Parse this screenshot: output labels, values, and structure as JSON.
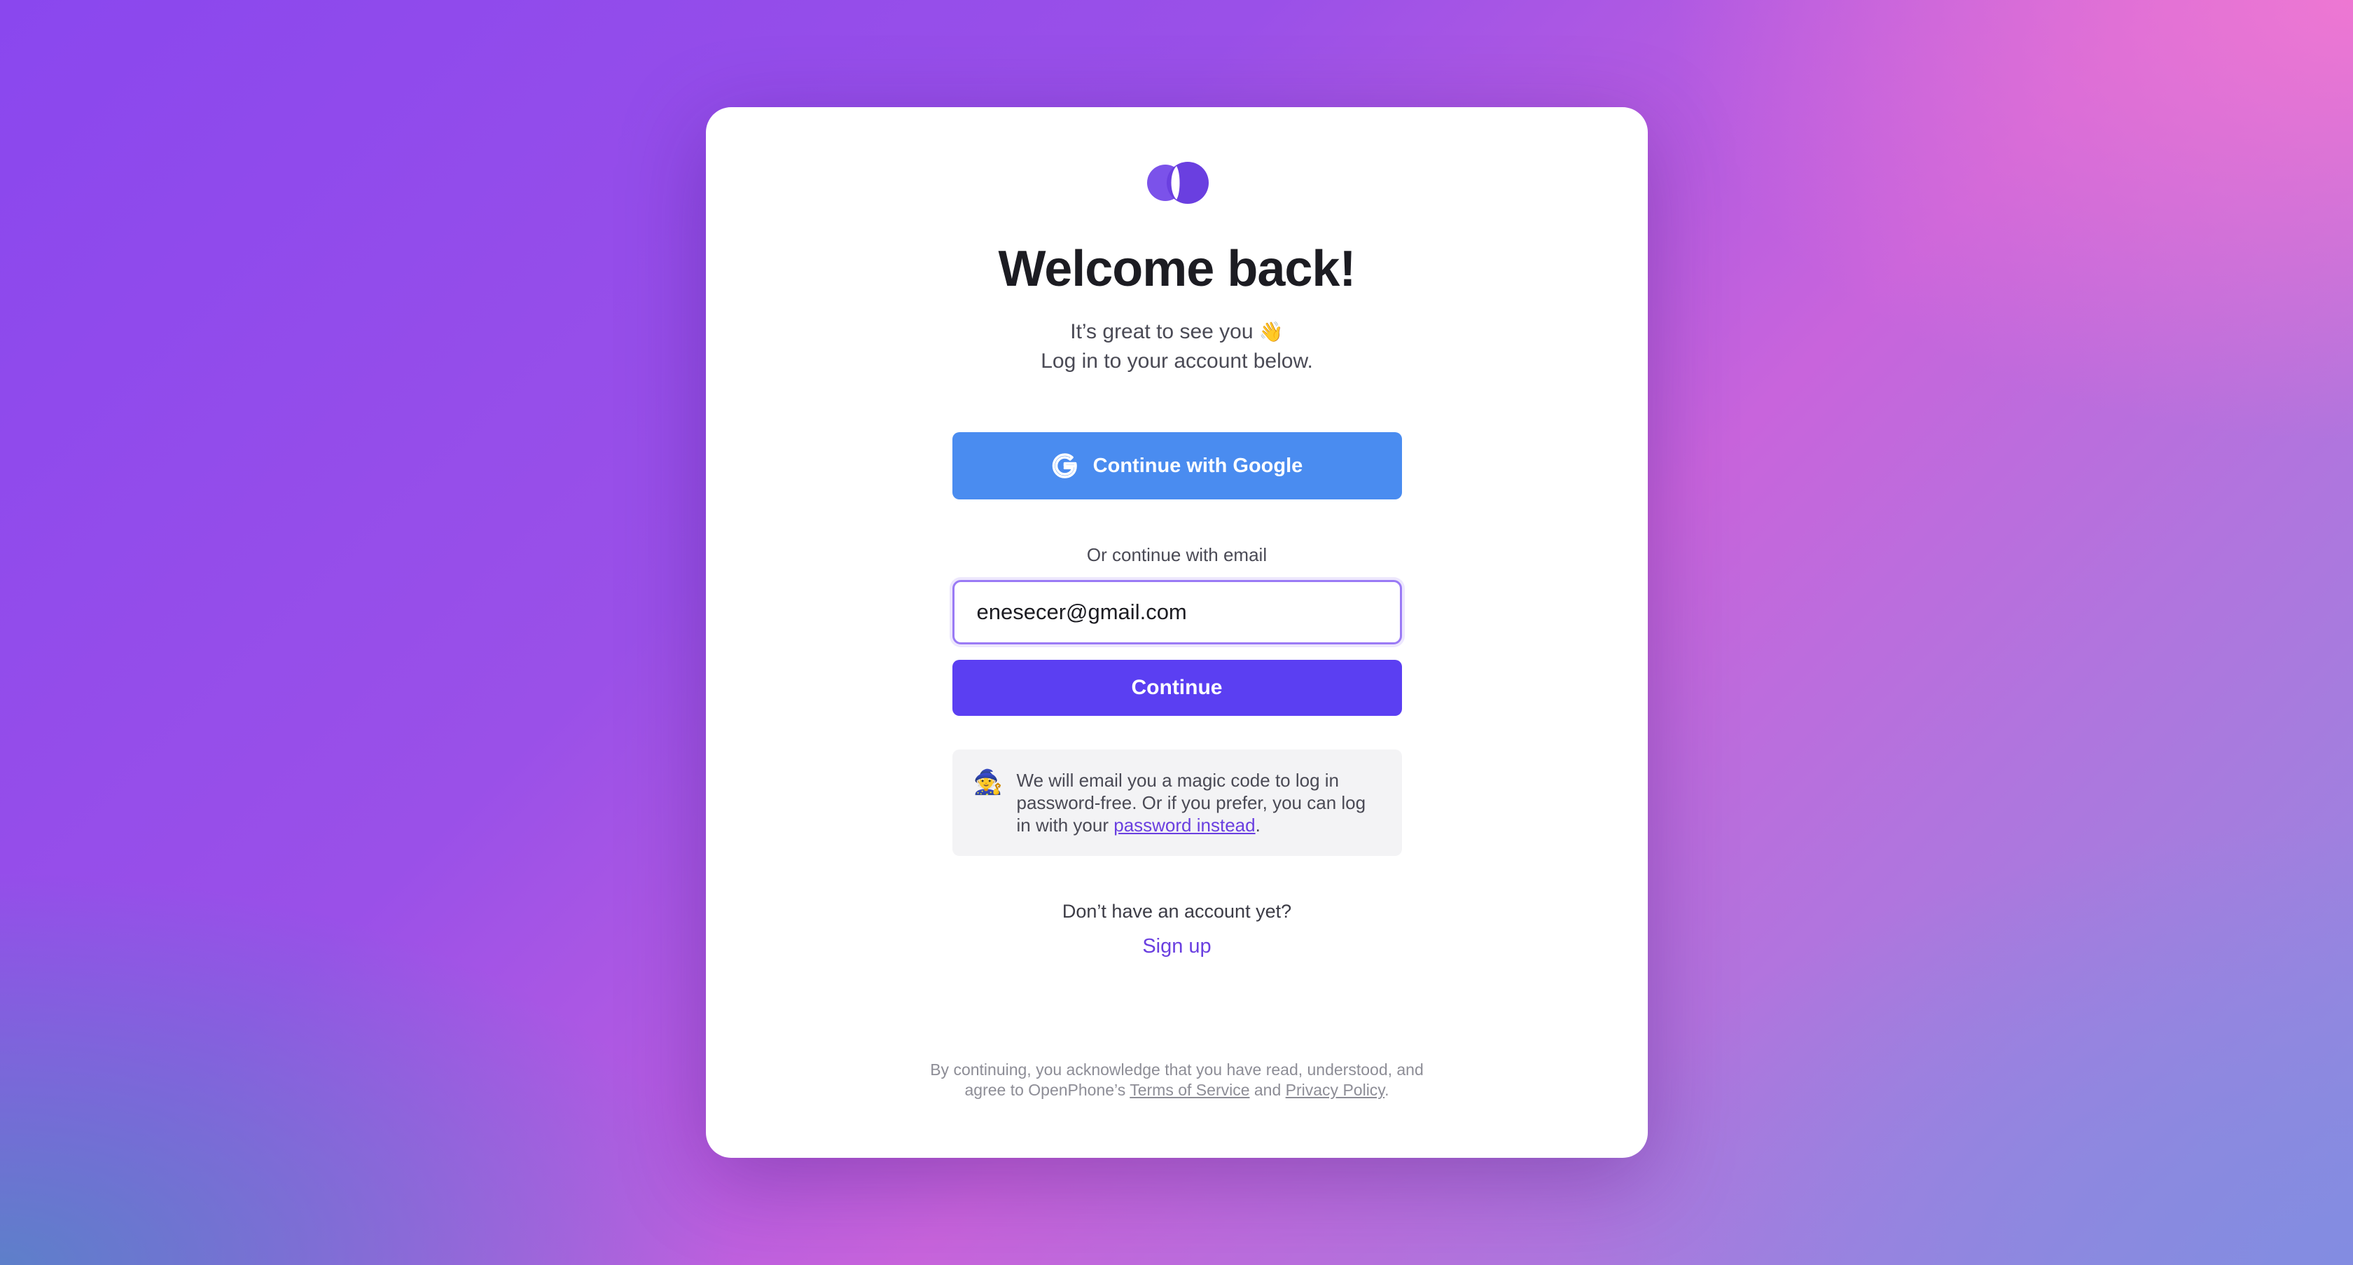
{
  "logo": {
    "icon": "openphone-logo-icon",
    "color": "#6a3fe0"
  },
  "heading": "Welcome back!",
  "subtitle": {
    "line1": "It’s great to see you",
    "wave_emoji": "👋",
    "line2": "Log in to your account below."
  },
  "google_button": {
    "label": "Continue with Google",
    "icon": "google-g-icon",
    "color": "#4a8cf0"
  },
  "email_section": {
    "or_label": "Or continue with email",
    "email_value": "enesecer@gmail.com",
    "continue_label": "Continue",
    "continue_color": "#5b3ff2"
  },
  "info": {
    "icon": "🧙",
    "text_before": "We will email you a magic code to log in password-free. Or if you prefer, you can log in with your ",
    "link": "password instead",
    "text_after": "."
  },
  "signup": {
    "prompt": "Don’t have an account yet?",
    "link": "Sign up"
  },
  "legal": {
    "line1": "By continuing, you acknowledge that you have read, understood, and",
    "line2_before": "agree to OpenPhone’s ",
    "terms": "Terms of Service",
    "and": " and ",
    "privacy": "Privacy Policy",
    "end": "."
  }
}
